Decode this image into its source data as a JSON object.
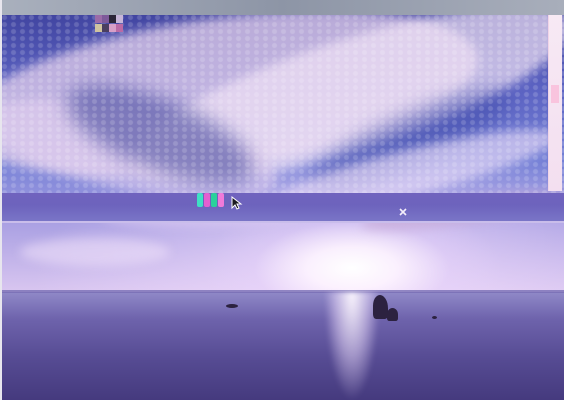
{
  "desktop": {
    "wallpaper": {
      "scene": "sunset-over-sea",
      "colors": {
        "sky_top": "#3c3f9a",
        "sky_low": "#d9c6f0",
        "sea": "#574c94",
        "sun": "#ffffff",
        "rock": "#2c2240"
      }
    },
    "icons": {
      "tray_icon": "grid-tray-icon",
      "app_icon": "app-icon",
      "cursor": "pointer-cursor-icon",
      "close": "close-icon"
    },
    "glitch_colors": {
      "top_band": "#a9b0bd",
      "mid_band": "#7063be",
      "side_panel": "#f7e9f4"
    }
  }
}
